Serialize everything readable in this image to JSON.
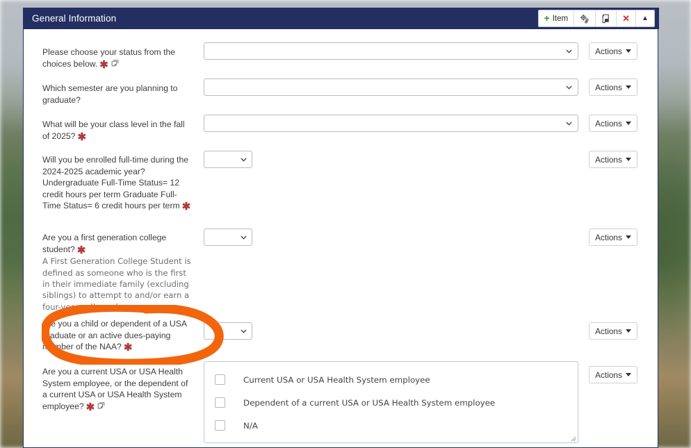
{
  "panel": {
    "title": "General Information"
  },
  "toolbar": {
    "add_item_label": "Item",
    "add_item_icon": "plus-icon",
    "settings_icon": "gear-settings-icon",
    "copy_icon": "document-copy-icon",
    "close_icon": "close-x-icon",
    "collapse_icon": "chevron-up-icon"
  },
  "common": {
    "actions_label": "Actions",
    "required_marker": "✱",
    "note_icon": "note-comment-icon",
    "dropdown_icon": "chevron-down-icon",
    "select_value": ""
  },
  "colors": {
    "header_bg": "#232f61",
    "required_red": "#b23a3a",
    "plus_green": "#2e9642",
    "close_red": "#cf2a2a",
    "annotation_orange": "#f2650d"
  },
  "questions": [
    {
      "id": "status",
      "label": "Please choose your status from the choices below.",
      "required": true,
      "has_note_icon": true,
      "help": "",
      "control": "select-wide",
      "value": "",
      "actions_label": "Actions"
    },
    {
      "id": "graduation-semester",
      "label": "Which semester are you planning to graduate?",
      "required": false,
      "has_note_icon": false,
      "help": "",
      "control": "select-wide",
      "value": "",
      "actions_label": "Actions"
    },
    {
      "id": "class-level-fall-2025",
      "label": "What will be your class level in the fall of 2025?",
      "required": true,
      "has_note_icon": false,
      "help": "",
      "control": "select-wide",
      "value": "",
      "actions_label": "Actions"
    },
    {
      "id": "full-time-enrollment",
      "label": "Will you be enrolled full-time during the 2024-2025 academic year? Undergraduate Full-Time Status= 12 credit hours per term Graduate Full-Time Status= 6 credit hours per term",
      "required": true,
      "has_note_icon": false,
      "help": "",
      "control": "select-narrow",
      "value": "",
      "actions_label": "Actions"
    },
    {
      "id": "first-generation",
      "label": "Are you a first generation college student?",
      "required": true,
      "has_note_icon": false,
      "help": "A First Generation College Student is defined as someone who is the first in their immediate family (excluding siblings) to attempt to and/or earn a four-year college degree.",
      "control": "select-narrow",
      "value": "",
      "actions_label": "Actions"
    },
    {
      "id": "usa-graduate-naa-dependent",
      "label": "Are you a child or dependent of a USA graduate or an active dues-paying member of the NAA?",
      "required": true,
      "has_note_icon": false,
      "help": "",
      "control": "select-narrow",
      "value": "",
      "actions_label": "Actions",
      "annotated": true
    },
    {
      "id": "usa-employee-dependent",
      "label": "Are you a current USA or USA Health System employee, or the dependent of a current USA or USA Health System employee?",
      "required": true,
      "has_note_icon": true,
      "help": "",
      "control": "checkbox-group",
      "actions_label": "Actions",
      "options": [
        {
          "label": "Current USA or USA Health System employee",
          "checked": false
        },
        {
          "label": "Dependent of a current USA or USA Health System employee",
          "checked": false
        },
        {
          "label": "N/A",
          "checked": false
        }
      ]
    }
  ],
  "annotation": {
    "type": "hand-drawn-ellipse",
    "color": "#f2650d",
    "target": "usa-graduate-naa-dependent"
  }
}
